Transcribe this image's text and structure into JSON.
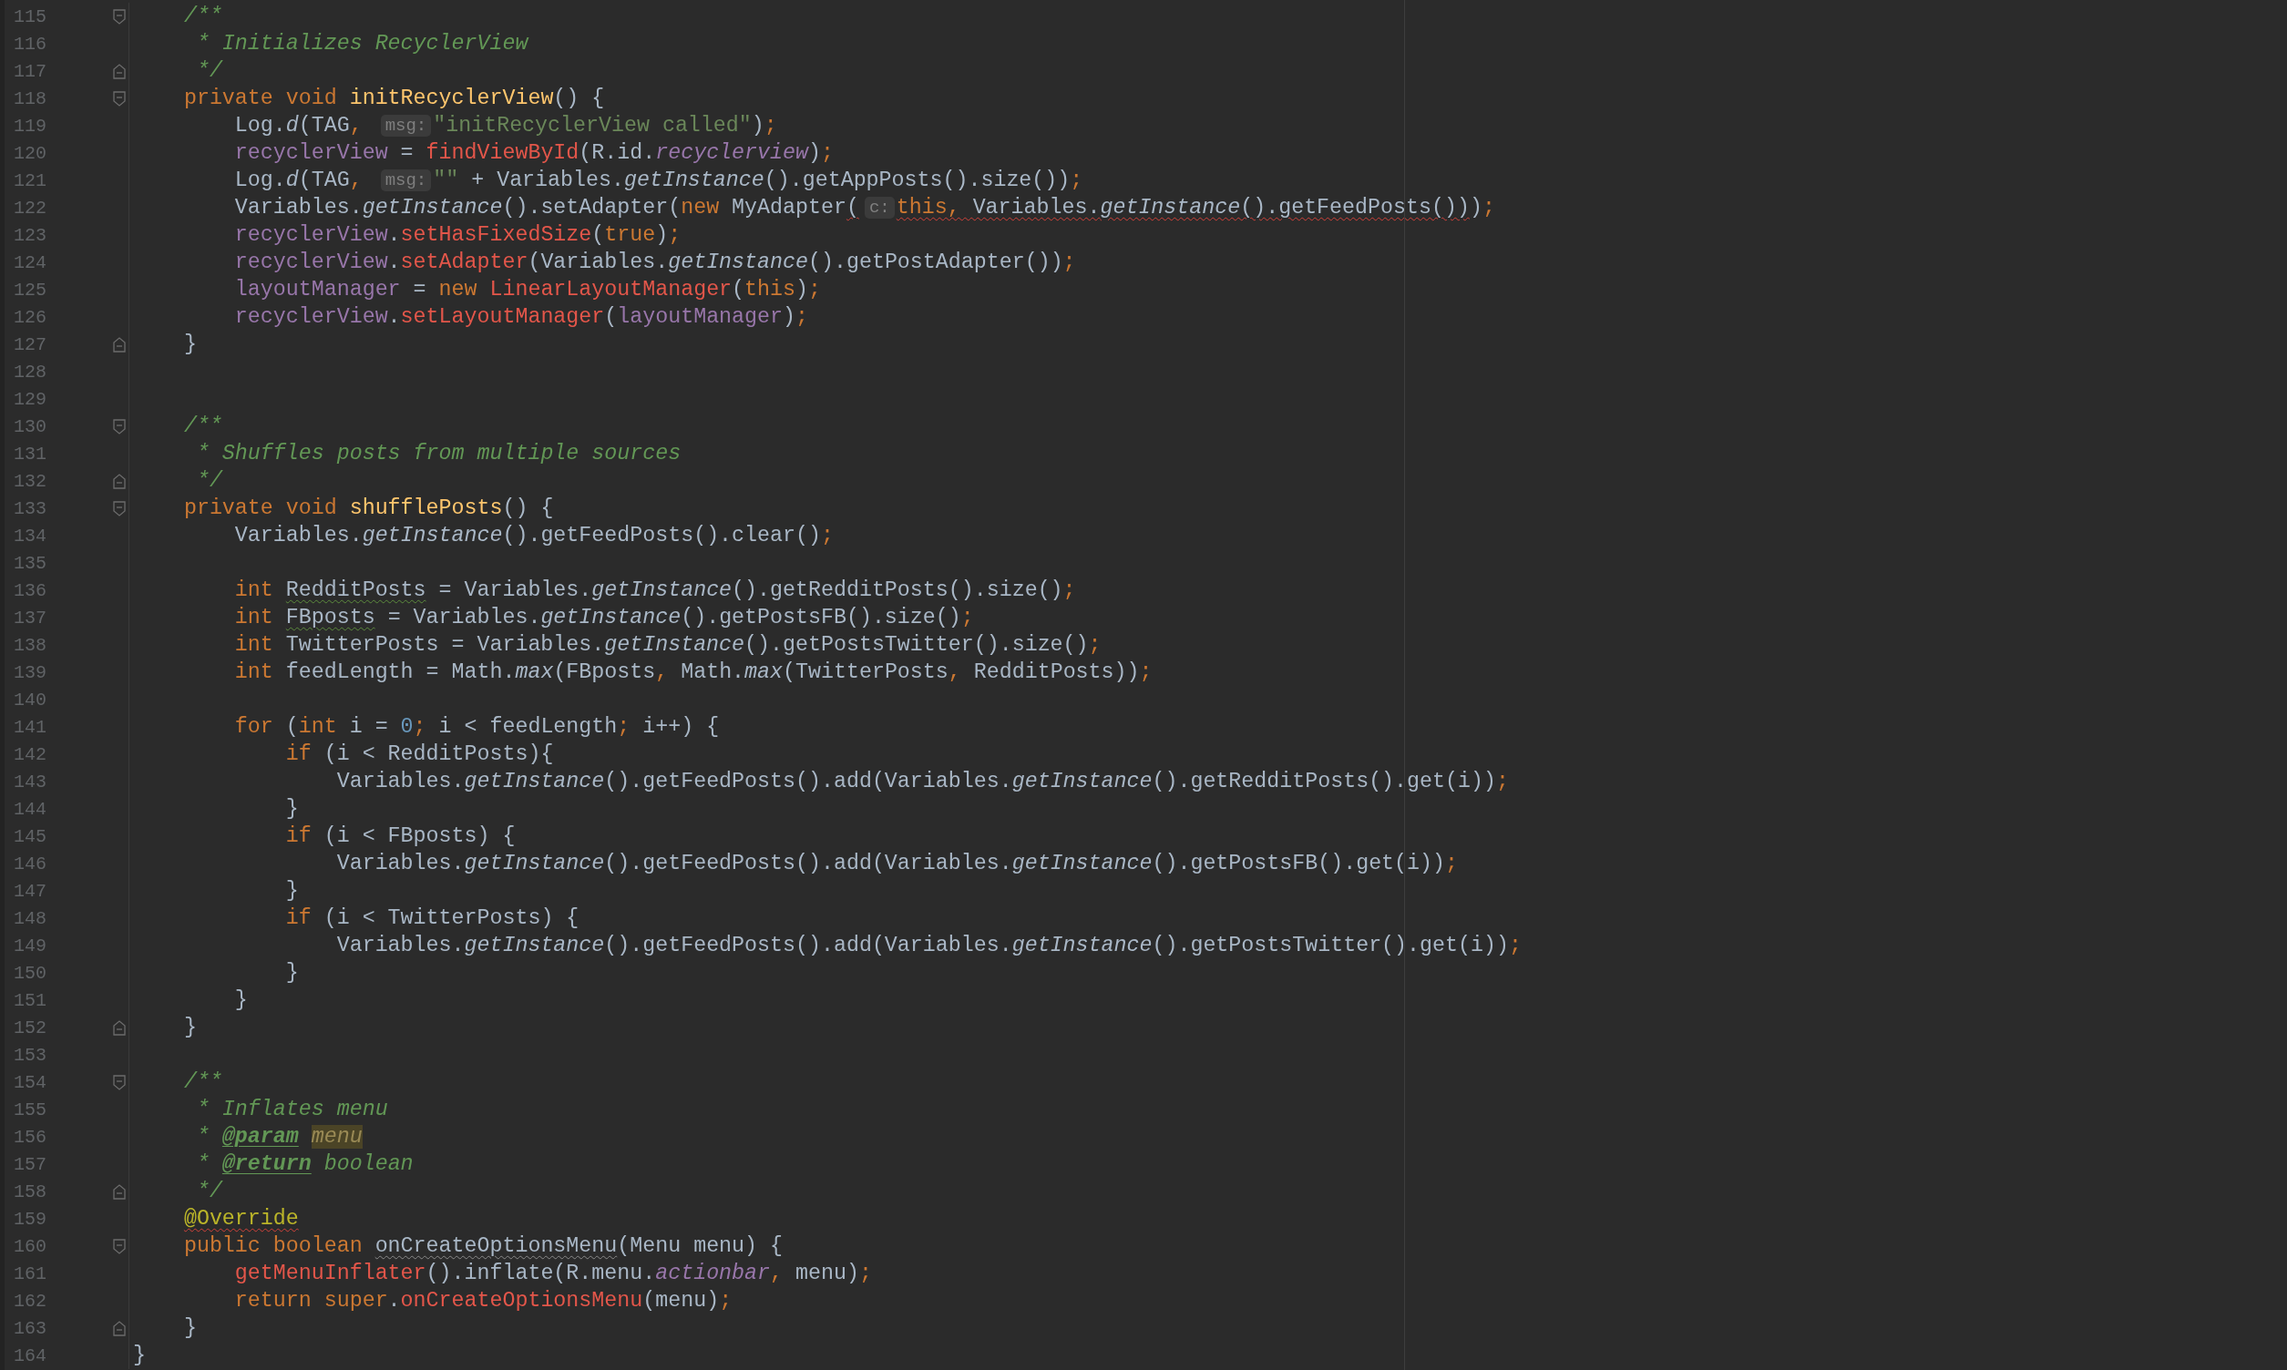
{
  "editor": {
    "lines": [
      {
        "number": "115",
        "fold_open": true,
        "tokens": [
          {
            "kind": "doc",
            "text": "    /**"
          }
        ]
      },
      {
        "number": "116",
        "tokens": [
          {
            "kind": "doc",
            "text": "     * Initializes RecyclerView"
          }
        ]
      },
      {
        "number": "117",
        "fold_close": true,
        "tokens": [
          {
            "kind": "doc",
            "text": "     */"
          }
        ]
      },
      {
        "number": "118",
        "fold_open": true,
        "tokens": [
          {
            "kind": "keyword",
            "text": "    private void "
          },
          {
            "kind": "declaration",
            "text": "initRecyclerView"
          },
          {
            "kind": "plain",
            "text": "() {"
          }
        ]
      },
      {
        "number": "119",
        "tokens": [
          {
            "kind": "plain",
            "text": "        Log."
          },
          {
            "kind": "static",
            "text": "d"
          },
          {
            "kind": "plain",
            "text": "(TAG"
          },
          {
            "kind": "keyword",
            "text": ", "
          },
          {
            "kind": "hint",
            "text": "msg:"
          },
          {
            "kind": "string",
            "text": "\"initRecyclerView called\""
          },
          {
            "kind": "plain",
            "text": ")"
          },
          {
            "kind": "keyword",
            "text": ";"
          }
        ]
      },
      {
        "number": "120",
        "tokens": [
          {
            "kind": "field",
            "text": "        recyclerView"
          },
          {
            "kind": "plain",
            "text": " = "
          },
          {
            "kind": "call",
            "text": "findViewById"
          },
          {
            "kind": "plain",
            "text": "(R.id."
          },
          {
            "kind": "static_field",
            "text": "recyclerview"
          },
          {
            "kind": "plain",
            "text": ")"
          },
          {
            "kind": "keyword",
            "text": ";"
          }
        ]
      },
      {
        "number": "121",
        "tokens": [
          {
            "kind": "plain",
            "text": "        Log."
          },
          {
            "kind": "static",
            "text": "d"
          },
          {
            "kind": "plain",
            "text": "(TAG"
          },
          {
            "kind": "keyword",
            "text": ", "
          },
          {
            "kind": "hint",
            "text": "msg:"
          },
          {
            "kind": "string",
            "text": "\"\""
          },
          {
            "kind": "plain",
            "text": " + Variables."
          },
          {
            "kind": "static",
            "text": "getInstance"
          },
          {
            "kind": "plain",
            "text": "().getAppPosts().size())"
          },
          {
            "kind": "keyword",
            "text": ";"
          }
        ]
      },
      {
        "number": "122",
        "tokens": [
          {
            "kind": "plain",
            "text": "        Variables."
          },
          {
            "kind": "static",
            "text": "getInstance"
          },
          {
            "kind": "plain",
            "text": "().setAdapter("
          },
          {
            "kind": "keyword",
            "text": "new "
          },
          {
            "kind": "plain",
            "text": "MyAdapter"
          },
          {
            "kind": "plain",
            "text": "(",
            "error": true
          },
          {
            "kind": "hint",
            "text": "c:"
          },
          {
            "kind": "keyword",
            "text": "this, ",
            "error": true
          },
          {
            "kind": "plain",
            "text": "Variables.",
            "error": true
          },
          {
            "kind": "static",
            "text": "getInstance",
            "error": true
          },
          {
            "kind": "plain",
            "text": "().getFeedPosts())",
            "error": true
          },
          {
            "kind": "plain",
            "text": ")"
          },
          {
            "kind": "keyword",
            "text": ";"
          }
        ]
      },
      {
        "number": "123",
        "tokens": [
          {
            "kind": "field",
            "text": "        recyclerView"
          },
          {
            "kind": "plain",
            "text": "."
          },
          {
            "kind": "call",
            "text": "setHasFixedSize"
          },
          {
            "kind": "plain",
            "text": "("
          },
          {
            "kind": "keyword",
            "text": "true"
          },
          {
            "kind": "plain",
            "text": ")"
          },
          {
            "kind": "keyword",
            "text": ";"
          }
        ]
      },
      {
        "number": "124",
        "tokens": [
          {
            "kind": "field",
            "text": "        recyclerView"
          },
          {
            "kind": "plain",
            "text": "."
          },
          {
            "kind": "call",
            "text": "setAdapter"
          },
          {
            "kind": "plain",
            "text": "(Variables."
          },
          {
            "kind": "static",
            "text": "getInstance"
          },
          {
            "kind": "plain",
            "text": "().getPostAdapter())"
          },
          {
            "kind": "keyword",
            "text": ";"
          }
        ]
      },
      {
        "number": "125",
        "tokens": [
          {
            "kind": "field",
            "text": "        layoutManager"
          },
          {
            "kind": "plain",
            "text": " = "
          },
          {
            "kind": "keyword",
            "text": "new "
          },
          {
            "kind": "call",
            "text": "LinearLayoutManager"
          },
          {
            "kind": "plain",
            "text": "("
          },
          {
            "kind": "keyword",
            "text": "this"
          },
          {
            "kind": "plain",
            "text": ")"
          },
          {
            "kind": "keyword",
            "text": ";"
          }
        ]
      },
      {
        "number": "126",
        "tokens": [
          {
            "kind": "field",
            "text": "        recyclerView"
          },
          {
            "kind": "plain",
            "text": "."
          },
          {
            "kind": "call",
            "text": "setLayoutManager"
          },
          {
            "kind": "plain",
            "text": "("
          },
          {
            "kind": "field",
            "text": "layoutManager"
          },
          {
            "kind": "plain",
            "text": ")"
          },
          {
            "kind": "keyword",
            "text": ";"
          }
        ]
      },
      {
        "number": "127",
        "fold_close": true,
        "tokens": [
          {
            "kind": "plain",
            "text": "    }"
          }
        ]
      },
      {
        "number": "128"
      },
      {
        "number": "129"
      },
      {
        "number": "130",
        "fold_open": true,
        "tokens": [
          {
            "kind": "doc",
            "text": "    /**"
          }
        ]
      },
      {
        "number": "131",
        "tokens": [
          {
            "kind": "doc",
            "text": "     * Shuffles posts from multiple sources"
          }
        ]
      },
      {
        "number": "132",
        "fold_close": true,
        "tokens": [
          {
            "kind": "doc",
            "text": "     */"
          }
        ]
      },
      {
        "number": "133",
        "fold_open": true,
        "tokens": [
          {
            "kind": "keyword",
            "text": "    private void "
          },
          {
            "kind": "declaration",
            "text": "shufflePosts"
          },
          {
            "kind": "plain",
            "text": "() {"
          }
        ]
      },
      {
        "number": "134",
        "tokens": [
          {
            "kind": "plain",
            "text": "        Variables."
          },
          {
            "kind": "static",
            "text": "getInstance"
          },
          {
            "kind": "plain",
            "text": "().getFeedPosts().clear()"
          },
          {
            "kind": "keyword",
            "text": ";"
          }
        ]
      },
      {
        "number": "135"
      },
      {
        "number": "136",
        "tokens": [
          {
            "kind": "keyword",
            "text": "        int "
          },
          {
            "kind": "plain",
            "text": "RedditPosts",
            "typo": true
          },
          {
            "kind": "plain",
            "text": " = Variables."
          },
          {
            "kind": "static",
            "text": "getInstance"
          },
          {
            "kind": "plain",
            "text": "().getRedditPosts().size()"
          },
          {
            "kind": "keyword",
            "text": ";"
          }
        ]
      },
      {
        "number": "137",
        "tokens": [
          {
            "kind": "keyword",
            "text": "        int "
          },
          {
            "kind": "plain",
            "text": "FBposts",
            "typo": true
          },
          {
            "kind": "plain",
            "text": " = Variables."
          },
          {
            "kind": "static",
            "text": "getInstance"
          },
          {
            "kind": "plain",
            "text": "().getPostsFB().size()"
          },
          {
            "kind": "keyword",
            "text": ";"
          }
        ]
      },
      {
        "number": "138",
        "tokens": [
          {
            "kind": "keyword",
            "text": "        int "
          },
          {
            "kind": "plain",
            "text": "TwitterPosts = Variables."
          },
          {
            "kind": "static",
            "text": "getInstance"
          },
          {
            "kind": "plain",
            "text": "().getPostsTwitter().size()"
          },
          {
            "kind": "keyword",
            "text": ";"
          }
        ]
      },
      {
        "number": "139",
        "tokens": [
          {
            "kind": "keyword",
            "text": "        int "
          },
          {
            "kind": "plain",
            "text": "feedLength = Math."
          },
          {
            "kind": "static",
            "text": "max"
          },
          {
            "kind": "plain",
            "text": "(FBposts"
          },
          {
            "kind": "keyword",
            "text": ", "
          },
          {
            "kind": "plain",
            "text": "Math."
          },
          {
            "kind": "static",
            "text": "max"
          },
          {
            "kind": "plain",
            "text": "(TwitterPosts"
          },
          {
            "kind": "keyword",
            "text": ", "
          },
          {
            "kind": "plain",
            "text": "RedditPosts))"
          },
          {
            "kind": "keyword",
            "text": ";"
          }
        ]
      },
      {
        "number": "140"
      },
      {
        "number": "141",
        "tokens": [
          {
            "kind": "keyword",
            "text": "        for "
          },
          {
            "kind": "plain",
            "text": "("
          },
          {
            "kind": "keyword",
            "text": "int "
          },
          {
            "kind": "plain",
            "text": "i = "
          },
          {
            "kind": "number",
            "text": "0"
          },
          {
            "kind": "keyword",
            "text": "; "
          },
          {
            "kind": "plain",
            "text": "i < feedLength"
          },
          {
            "kind": "keyword",
            "text": "; "
          },
          {
            "kind": "plain",
            "text": "i++) {"
          }
        ]
      },
      {
        "number": "142",
        "tokens": [
          {
            "kind": "keyword",
            "text": "            if "
          },
          {
            "kind": "plain",
            "text": "(i < RedditPosts){"
          }
        ]
      },
      {
        "number": "143",
        "tokens": [
          {
            "kind": "plain",
            "text": "                Variables."
          },
          {
            "kind": "static",
            "text": "getInstance"
          },
          {
            "kind": "plain",
            "text": "().getFeedPosts().add(Variables."
          },
          {
            "kind": "static",
            "text": "getInstance"
          },
          {
            "kind": "plain",
            "text": "().getRedditPosts().get(i))"
          },
          {
            "kind": "keyword",
            "text": ";"
          }
        ]
      },
      {
        "number": "144",
        "tokens": [
          {
            "kind": "plain",
            "text": "            }"
          }
        ]
      },
      {
        "number": "145",
        "tokens": [
          {
            "kind": "keyword",
            "text": "            if "
          },
          {
            "kind": "plain",
            "text": "(i < FBposts) {"
          }
        ]
      },
      {
        "number": "146",
        "tokens": [
          {
            "kind": "plain",
            "text": "                Variables."
          },
          {
            "kind": "static",
            "text": "getInstance"
          },
          {
            "kind": "plain",
            "text": "().getFeedPosts().add(Variables."
          },
          {
            "kind": "static",
            "text": "getInstance"
          },
          {
            "kind": "plain",
            "text": "().getPostsFB().get(i))"
          },
          {
            "kind": "keyword",
            "text": ";"
          }
        ]
      },
      {
        "number": "147",
        "tokens": [
          {
            "kind": "plain",
            "text": "            }"
          }
        ]
      },
      {
        "number": "148",
        "tokens": [
          {
            "kind": "keyword",
            "text": "            if "
          },
          {
            "kind": "plain",
            "text": "(i < TwitterPosts) {"
          }
        ]
      },
      {
        "number": "149",
        "tokens": [
          {
            "kind": "plain",
            "text": "                Variables."
          },
          {
            "kind": "static",
            "text": "getInstance"
          },
          {
            "kind": "plain",
            "text": "().getFeedPosts().add(Variables."
          },
          {
            "kind": "static",
            "text": "getInstance"
          },
          {
            "kind": "plain",
            "text": "().getPostsTwitter().get(i))"
          },
          {
            "kind": "keyword",
            "text": ";"
          }
        ]
      },
      {
        "number": "150",
        "tokens": [
          {
            "kind": "plain",
            "text": "            }"
          }
        ]
      },
      {
        "number": "151",
        "tokens": [
          {
            "kind": "plain",
            "text": "        }"
          }
        ]
      },
      {
        "number": "152",
        "fold_close": true,
        "tokens": [
          {
            "kind": "plain",
            "text": "    }"
          }
        ]
      },
      {
        "number": "153"
      },
      {
        "number": "154",
        "fold_open": true,
        "tokens": [
          {
            "kind": "doc",
            "text": "    /**"
          }
        ]
      },
      {
        "number": "155",
        "tokens": [
          {
            "kind": "doc",
            "text": "     * Inflates menu"
          }
        ]
      },
      {
        "number": "156",
        "tokens": [
          {
            "kind": "doc",
            "text": "     * "
          },
          {
            "kind": "doc_tag",
            "text": "@param"
          },
          {
            "kind": "doc_param",
            "text": "menu"
          }
        ]
      },
      {
        "number": "157",
        "tokens": [
          {
            "kind": "doc",
            "text": "     * "
          },
          {
            "kind": "doc_tag",
            "text": "@return"
          },
          {
            "kind": "doc",
            "text": " boolean"
          }
        ]
      },
      {
        "number": "158",
        "fold_close": true,
        "tokens": [
          {
            "kind": "doc",
            "text": "     */"
          }
        ]
      },
      {
        "number": "159",
        "tokens": [
          {
            "kind": "annotation",
            "text": "    @Override",
            "error": true
          }
        ]
      },
      {
        "number": "160",
        "fold_open": true,
        "tokens": [
          {
            "kind": "keyword",
            "text": "    public boolean "
          },
          {
            "kind": "plain",
            "text": "onCreateOptionsMenu",
            "warning": true
          },
          {
            "kind": "plain",
            "text": "(Menu menu) {"
          }
        ]
      },
      {
        "number": "161",
        "tokens": [
          {
            "kind": "call",
            "text": "        getMenuInflater"
          },
          {
            "kind": "plain",
            "text": "().inflate(R.menu."
          },
          {
            "kind": "static_field",
            "text": "actionbar"
          },
          {
            "kind": "keyword",
            "text": ", "
          },
          {
            "kind": "plain",
            "text": "menu)"
          },
          {
            "kind": "keyword",
            "text": ";"
          }
        ]
      },
      {
        "number": "162",
        "tokens": [
          {
            "kind": "keyword",
            "text": "        return super"
          },
          {
            "kind": "plain",
            "text": "."
          },
          {
            "kind": "call",
            "text": "onCreateOptionsMenu"
          },
          {
            "kind": "plain",
            "text": "(menu)"
          },
          {
            "kind": "keyword",
            "text": ";"
          }
        ]
      },
      {
        "number": "163",
        "fold_close": true,
        "tokens": [
          {
            "kind": "plain",
            "text": "    }"
          }
        ]
      },
      {
        "number": "164",
        "tokens": [
          {
            "kind": "plain",
            "text": "}"
          }
        ]
      }
    ]
  }
}
